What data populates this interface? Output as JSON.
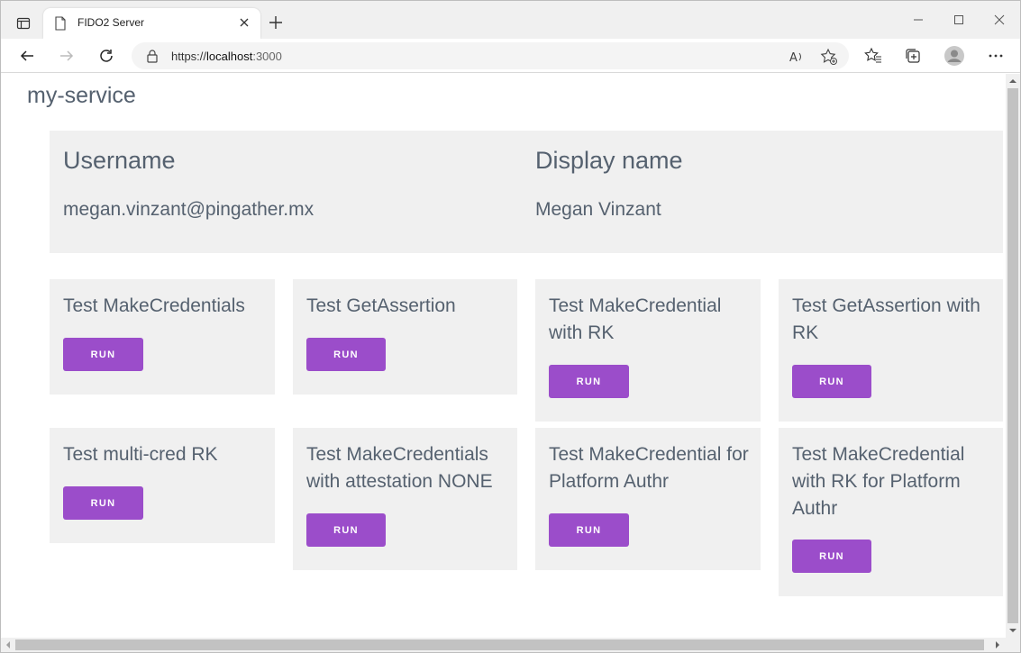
{
  "browser": {
    "tab_title": "FIDO2 Server",
    "url_scheme": "https://",
    "url_host": "localhost",
    "url_port": ":3000"
  },
  "page": {
    "service_title": "my-service",
    "user": {
      "username_label": "Username",
      "username_value": "megan.vinzant@pingather.mx",
      "displayname_label": "Display name",
      "displayname_value": "Megan Vinzant"
    },
    "tests": [
      {
        "title": "Test MakeCredentials",
        "button": "RUN"
      },
      {
        "title": "Test GetAssertion",
        "button": "RUN"
      },
      {
        "title": "Test MakeCredential with RK",
        "button": "RUN"
      },
      {
        "title": "Test GetAssertion with RK",
        "button": "RUN"
      },
      {
        "title": "Test multi-cred RK",
        "button": "RUN"
      },
      {
        "title": "Test MakeCredentials with attestation NONE",
        "button": "RUN"
      },
      {
        "title": "Test MakeCredential for Platform Authr",
        "button": "RUN"
      },
      {
        "title": "Test MakeCredential with RK for Platform Authr",
        "button": "RUN"
      }
    ]
  },
  "colors": {
    "accent": "#9b4dca",
    "card_bg": "#f0f0f0",
    "text": "#55616f"
  }
}
